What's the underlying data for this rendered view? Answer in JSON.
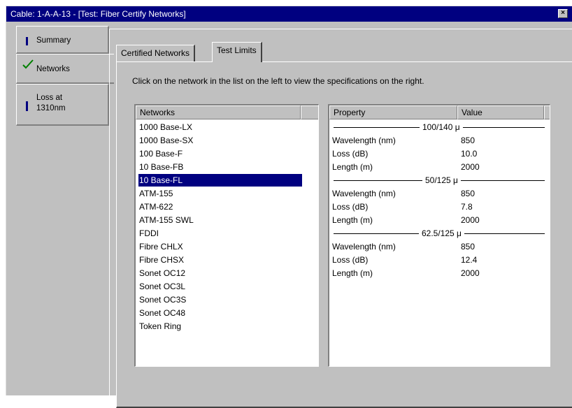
{
  "window": {
    "title": "Cable: 1-A-A-13 - [Test: Fiber Certify Networks]",
    "close_glyph": "×"
  },
  "nav": {
    "items": [
      {
        "label": "Summary"
      },
      {
        "label": "Networks"
      },
      {
        "label_line1": "Loss at",
        "label_line2": "1310nm"
      }
    ]
  },
  "tabs": [
    {
      "label": "Certified Networks"
    },
    {
      "label": "Test Limits"
    }
  ],
  "instruction": "Click on the network in the list on the left to view the specifications on the right.",
  "networks": {
    "header": "Networks",
    "items": [
      "1000 Base-LX",
      "1000 Base-SX",
      "100 Base-F",
      "10 Base-FB",
      "10 Base-FL",
      "ATM-155",
      "ATM-622",
      "ATM-155 SWL",
      "FDDI",
      "Fibre CHLX",
      "Fibre CHSX",
      "Sonet OC12",
      "Sonet OC3L",
      "Sonet OC3S",
      "Sonet OC48",
      "Token Ring"
    ],
    "selected": "10 Base-FL"
  },
  "properties": {
    "header_property": "Property",
    "header_value": "Value",
    "groups": [
      {
        "name": "100/140 μ",
        "rows": [
          {
            "property": "Wavelength (nm)",
            "value": "850"
          },
          {
            "property": "Loss (dB)",
            "value": "10.0"
          },
          {
            "property": "Length (m)",
            "value": "2000"
          }
        ]
      },
      {
        "name": "50/125 μ",
        "rows": [
          {
            "property": "Wavelength (nm)",
            "value": "850"
          },
          {
            "property": "Loss (dB)",
            "value": "7.8"
          },
          {
            "property": "Length (m)",
            "value": "2000"
          }
        ]
      },
      {
        "name": "62.5/125 μ",
        "rows": [
          {
            "property": "Wavelength (nm)",
            "value": "850"
          },
          {
            "property": "Loss (dB)",
            "value": "12.4"
          },
          {
            "property": "Length (m)",
            "value": "2000"
          }
        ]
      }
    ]
  },
  "colors": {
    "title_bar": "#000080",
    "selection": "#000080",
    "check": "#008000",
    "face": "#c0c0c0"
  }
}
